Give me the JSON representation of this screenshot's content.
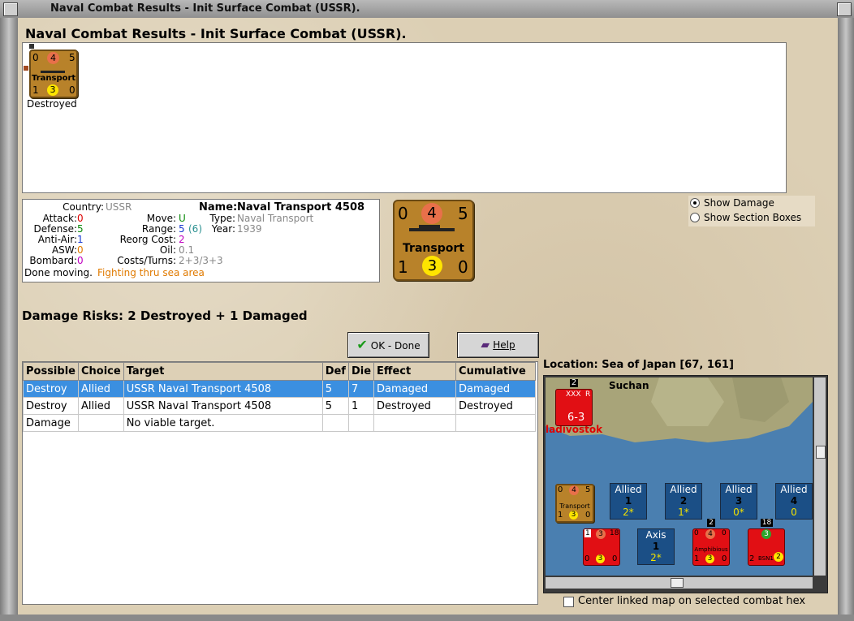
{
  "window": {
    "title": "Naval Combat Results - Init Surface Combat (USSR)."
  },
  "heading": "Naval Combat Results - Init Surface Combat (USSR).",
  "result_unit": {
    "top_left": "0",
    "top_mid": "4",
    "top_right": "5",
    "name": "Transport",
    "bot_left": "1",
    "bot_mid": "3",
    "bot_right": "0",
    "status": "Destroyed"
  },
  "unit_info": {
    "country_label": "Country:",
    "country": "USSR",
    "attack_label": "Attack:",
    "attack": "0",
    "defense_label": "Defense:",
    "defense": "5",
    "antiair_label": "Anti-Air:",
    "antiair": "1",
    "asw_label": "ASW:",
    "asw": "0",
    "bombard_label": "Bombard:",
    "bombard": "0",
    "move_label": "Move:",
    "move": "U",
    "range_label": "Range:",
    "range": "5",
    "range_extra": "(6)",
    "reorg_label": "Reorg Cost:",
    "reorg": "2",
    "oil_label": "Oil:",
    "oil": "0.1",
    "costs_label": "Costs/Turns:",
    "costs": "2+3/3+3",
    "name_label": "Name:",
    "name": "Naval Transport 4508",
    "type_label": "Type:",
    "type": "Naval Transport",
    "year_label": "Year:",
    "year": "1939",
    "status_text": "Done moving.",
    "status_extra": "Fighting thru sea area"
  },
  "big_counter": {
    "top_left": "0",
    "top_mid": "4",
    "top_right": "5",
    "name": "Transport",
    "bot_left": "1",
    "bot_mid": "3",
    "bot_right": "0"
  },
  "options": {
    "show_damage": "Show Damage",
    "show_section_boxes": "Show Section Boxes"
  },
  "damage_risks": "Damage Risks:  2 Destroyed + 1 Damaged",
  "buttons": {
    "ok": "OK - Done",
    "help": "Help"
  },
  "table": {
    "headers": [
      "Possible",
      "Choice",
      "Target",
      "Def",
      "Die",
      "Effect",
      "Cumulative"
    ],
    "rows": [
      [
        "Destroy",
        "Allied",
        "USSR Naval Transport 4508",
        "5",
        "7",
        "Damaged",
        "Damaged"
      ],
      [
        "Destroy",
        "Allied",
        "USSR Naval Transport 4508",
        "5",
        "1",
        "Destroyed",
        "Destroyed"
      ],
      [
        "Damage",
        "",
        "No viable target.",
        "",
        "",
        "",
        ""
      ]
    ]
  },
  "location": "Location:  Sea of Japan [67, 161]",
  "map": {
    "city": "Suchan",
    "city2": "ladivostok",
    "army": {
      "top": "XXX",
      "bottom": "6-3",
      "stack": "2",
      "flag": "R"
    },
    "slot_unit": {
      "top_left": "0",
      "top_mid": "4",
      "top_right": "5",
      "name": "Transport",
      "bot_left": "1",
      "bot_mid": "3",
      "bot_right": "0"
    },
    "allied_boxes": [
      {
        "label": "Allied",
        "num": "1",
        "sub": "2*"
      },
      {
        "label": "Allied",
        "num": "2",
        "sub": "1*"
      },
      {
        "label": "Allied",
        "num": "3",
        "sub": "0*"
      },
      {
        "label": "Allied",
        "num": "4",
        "sub": "0"
      }
    ],
    "axis_box": {
      "label": "Axis",
      "num": "1",
      "sub": "2*"
    },
    "red1": {
      "tl": "1",
      "tm": "3",
      "tr": "18",
      "bl": "0",
      "bm": "3",
      "br": "0"
    },
    "red2": {
      "tl": "0",
      "tm": "4",
      "tr": "0",
      "name": "Amphibious",
      "bl": "1",
      "bm": "3",
      "br": "0",
      "stack": "2"
    },
    "red3": {
      "tm": "3",
      "name": "BSN1",
      "bl": "2",
      "br": "2",
      "stack": "18"
    }
  },
  "center_map_label": "Center linked map on selected combat hex",
  "colors": {
    "selected_row": "#3b8fe0",
    "counter_brown": "#b8822a",
    "allied_blue": "#1b4f86",
    "axis_red": "#e10f14",
    "sea": "#4a7fb0"
  }
}
